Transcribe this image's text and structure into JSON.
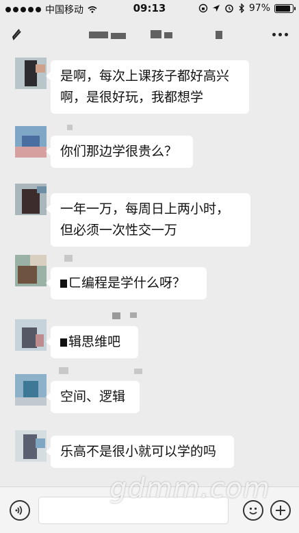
{
  "status_bar": {
    "carrier": "中国移动",
    "time": "09:13",
    "battery": "97%",
    "battery_level": 0.97
  },
  "nav": {
    "more_icon": "more-dots-icon",
    "back_icon": "back-arrow-icon"
  },
  "messages": [
    {
      "text": "是啊，每次上课孩子都好高兴\n啊，是很好玩，我都想学"
    },
    {
      "text": "你们那边学很贵么？"
    },
    {
      "text": "一年一万，每周日上两小时，\n但必须一次性交一万"
    },
    {
      "text": "ㄈ编程是学什么呀？"
    },
    {
      "text": "辑思维吧"
    },
    {
      "text": "空间、逻辑"
    },
    {
      "text": "乐高不是很小就可以学的吗"
    }
  ],
  "input_bar": {
    "voice_icon": "voice-icon",
    "emoji_icon": "emoji-icon",
    "plus_icon": "plus-icon"
  },
  "watermark": "gdmm.com"
}
